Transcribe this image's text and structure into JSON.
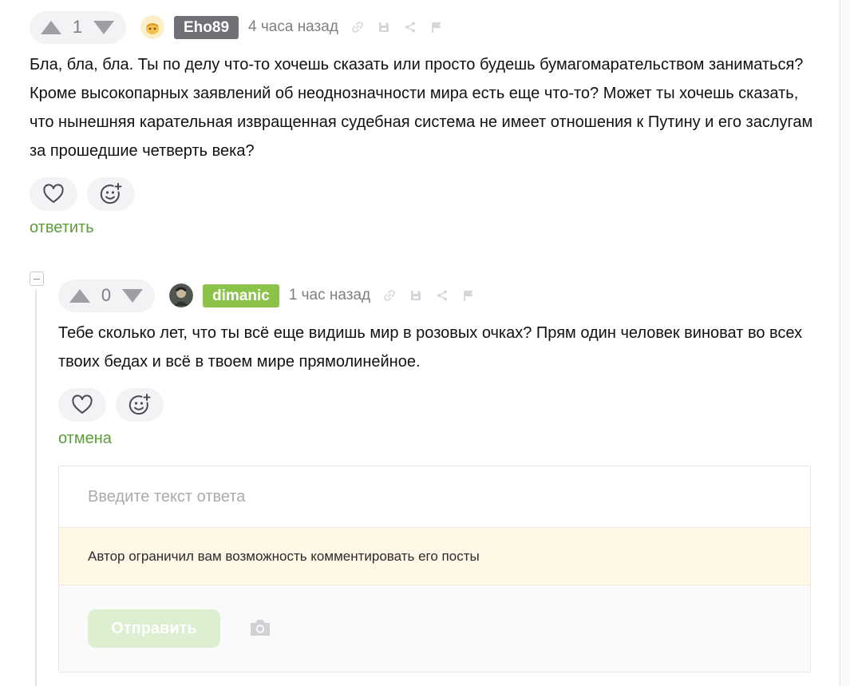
{
  "comments": [
    {
      "votes": "1",
      "username": "Eho89",
      "time": "4 часа назад",
      "text": "Бла, бла, бла. Ты по делу что-то хочешь сказать или просто будешь бумагомарательством заниматься? Кроме высокопарных заявлений об неоднозначности мира есть еще что-то? Может ты хочешь сказать, что нынешняя карательная извращенная судебная система не имеет отношения к Путину и его заслугам за прошедшие четверть века?",
      "action_link": "ответить",
      "badge_color": "#6f7176"
    },
    {
      "votes": "0",
      "username": "dimanic",
      "time": "1 час назад",
      "text": "Тебе сколько лет, что ты всё еще видишь мир в розовых очках? Прям один человек виноват во всех твоих бедах и всё в твоем мире прямолинейное.",
      "action_link": "отмена",
      "badge_color": "#8bc34a"
    }
  ],
  "reply": {
    "placeholder": "Введите текст ответа",
    "notice": "Автор ограничил вам возможность комментировать его посты",
    "send_label": "Отправить"
  },
  "icons": {
    "tools": [
      "link-icon",
      "save-icon",
      "share-icon",
      "flag-icon"
    ],
    "actions": [
      "heart-icon",
      "emoji-add-icon"
    ],
    "attach": "camera-icon"
  },
  "colors": {
    "accent_green": "#8bc34a",
    "link_green": "#5d9c3a",
    "notice_bg": "#fff8e6"
  }
}
